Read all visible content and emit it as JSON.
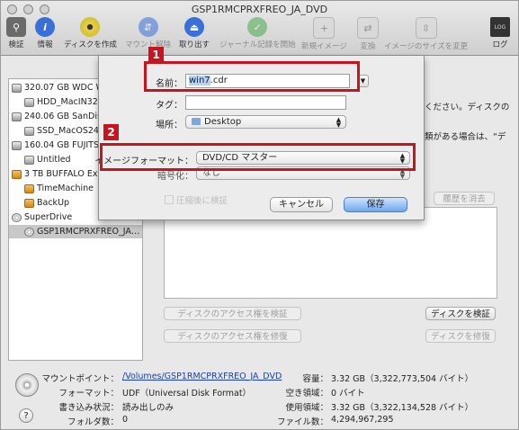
{
  "window": {
    "title": "GSP1RMCPRXFREO_JA_DVD"
  },
  "toolbar": {
    "items": [
      {
        "label": "検証",
        "icon": "microscope-icon",
        "color": "#555555",
        "enabled": true
      },
      {
        "label": "情報",
        "icon": "info-icon",
        "color": "#3a6fd8",
        "enabled": true
      },
      {
        "label": "ディスクを作成",
        "icon": "radiation-disc-icon",
        "color": "#c9b420",
        "enabled": true
      },
      {
        "label": "マウント解除",
        "icon": "unmount-icon",
        "color": "#3a6fd8",
        "enabled": false
      },
      {
        "label": "取り出す",
        "icon": "eject-icon",
        "color": "#3a6fd8",
        "enabled": true
      },
      {
        "label": "ジャーナル記録を開始",
        "icon": "journal-icon",
        "color": "#4aa84a",
        "enabled": false
      },
      {
        "label": "新規イメージ",
        "icon": "new-image-icon",
        "color": "#888888",
        "enabled": false
      },
      {
        "label": "変換",
        "icon": "convert-icon",
        "color": "#888888",
        "enabled": false
      },
      {
        "label": "イメージのサイズを変更",
        "icon": "resize-image-icon",
        "color": "#888888",
        "enabled": false
      },
      {
        "label": "ログ",
        "icon": "log-icon",
        "color": "#333333",
        "enabled": true
      }
    ]
  },
  "sidebar": {
    "items": [
      {
        "label": "320.07 GB WDC W…",
        "kind": "drive"
      },
      {
        "label": "HDD_MacIN320G…",
        "kind": "volume"
      },
      {
        "label": "240.06 GB SanDis…",
        "kind": "drive"
      },
      {
        "label": "SSD_MacOS240…",
        "kind": "volume"
      },
      {
        "label": "160.04 GB FUJITSU…",
        "kind": "drive"
      },
      {
        "label": "Untitled",
        "kind": "volume"
      },
      {
        "label": "3 TB BUFFALO Ext…",
        "kind": "drive-orange"
      },
      {
        "label": "TimeMachine",
        "kind": "volume-orange"
      },
      {
        "label": "BackUp",
        "kind": "volume-orange"
      },
      {
        "label": "SuperDrive",
        "kind": "superdrive"
      },
      {
        "label": "GSP1RMCPRXFREO_JA…",
        "kind": "disc",
        "selected": true
      }
    ]
  },
  "main": {
    "text_line1": "ください。ディスクの",
    "text_line2": "類がある場合は、“デ",
    "clear_history": "履歴を消去",
    "verify_permissions": "ディスクのアクセス権を検証",
    "repair_permissions": "ディスクのアクセス権を修復",
    "verify_disk": "ディスクを検証",
    "repair_disk": "ディスクを修復"
  },
  "info": {
    "rows_left": [
      {
        "label": "マウントポイント：",
        "value": "/Volumes/GSP1RMCPRXFREO_JA_DVD",
        "link": true
      },
      {
        "label": "フォーマット：",
        "value": "UDF（Universal Disk Format）"
      },
      {
        "label": "書き込み状況：",
        "value": "読み出しのみ"
      },
      {
        "label": "フォルダ数：",
        "value": "0"
      }
    ],
    "rows_right": [
      {
        "label": "容量：",
        "value": "3.32 GB（3,322,773,504 バイト）"
      },
      {
        "label": "空き領域：",
        "value": "0 バイト"
      },
      {
        "label": "使用領域：",
        "value": "3.32 GB（3,322,134,528 バイト）"
      },
      {
        "label": "ファイル数：",
        "value": "4,294,967,295"
      }
    ],
    "help": "?"
  },
  "sheet": {
    "name_label": "名前：",
    "name_value": "win7",
    "name_ext": ".cdr",
    "tag_label": "タグ：",
    "location_label": "場所：",
    "location_value": "Desktop",
    "format_label": "イメージフォーマット：",
    "format_value": "DVD/CD マスター",
    "encrypt_label": "暗号化：",
    "encrypt_value": "なし",
    "checkbox_label": "圧縮後に検証",
    "cancel": "キャンセル",
    "save": "保存"
  },
  "callouts": [
    {
      "number": "1",
      "color": "#c8141e"
    },
    {
      "number": "2",
      "color": "#c8141e"
    }
  ]
}
